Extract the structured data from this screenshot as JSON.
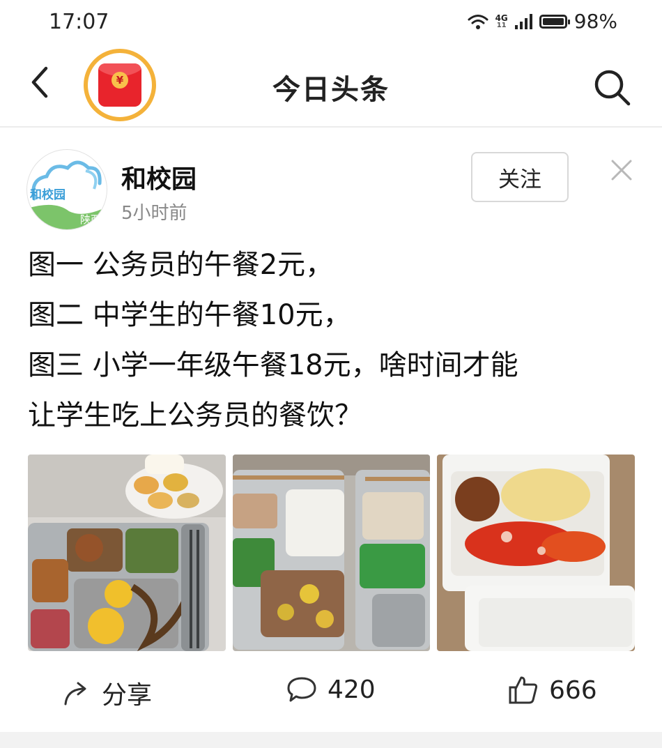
{
  "status_bar": {
    "time": "17:07",
    "network_top": "4G",
    "network_bottom": "11",
    "battery": "98%",
    "battery_level_percent": 98,
    "icons": [
      "wifi-icon",
      "signal-icon",
      "battery-icon"
    ]
  },
  "nav": {
    "title": "今日头条",
    "back_icon": "chevron-left-icon",
    "redpacket_icon": "red-envelope-icon",
    "redpacket_symbol": "¥",
    "search_icon": "search-icon"
  },
  "post": {
    "author": {
      "name": "和校园",
      "avatar_text": "和校园",
      "avatar_sub": "陕西",
      "time": "5小时前"
    },
    "follow_label": "关注",
    "close_icon": "close-icon",
    "text_lines": [
      "图一 公务员的午餐2元，",
      "图二 中学生的午餐10元，",
      "图三 小学一年级午餐18元，啥时间才能",
      "让学生吃上公务员的餐饮？"
    ],
    "images": [
      "lunch-photo-1",
      "lunch-photo-2",
      "lunch-photo-3"
    ]
  },
  "actions": {
    "share_label": "分享",
    "comment_count": "420",
    "like_count": "666",
    "icons": [
      "share-icon",
      "comment-icon",
      "thumbs-up-icon"
    ]
  },
  "colors": {
    "accent_red": "#e8242c",
    "ring_orange": "#f4b23a",
    "muted_text": "#888888",
    "brand_blue": "#3c9fd8"
  }
}
